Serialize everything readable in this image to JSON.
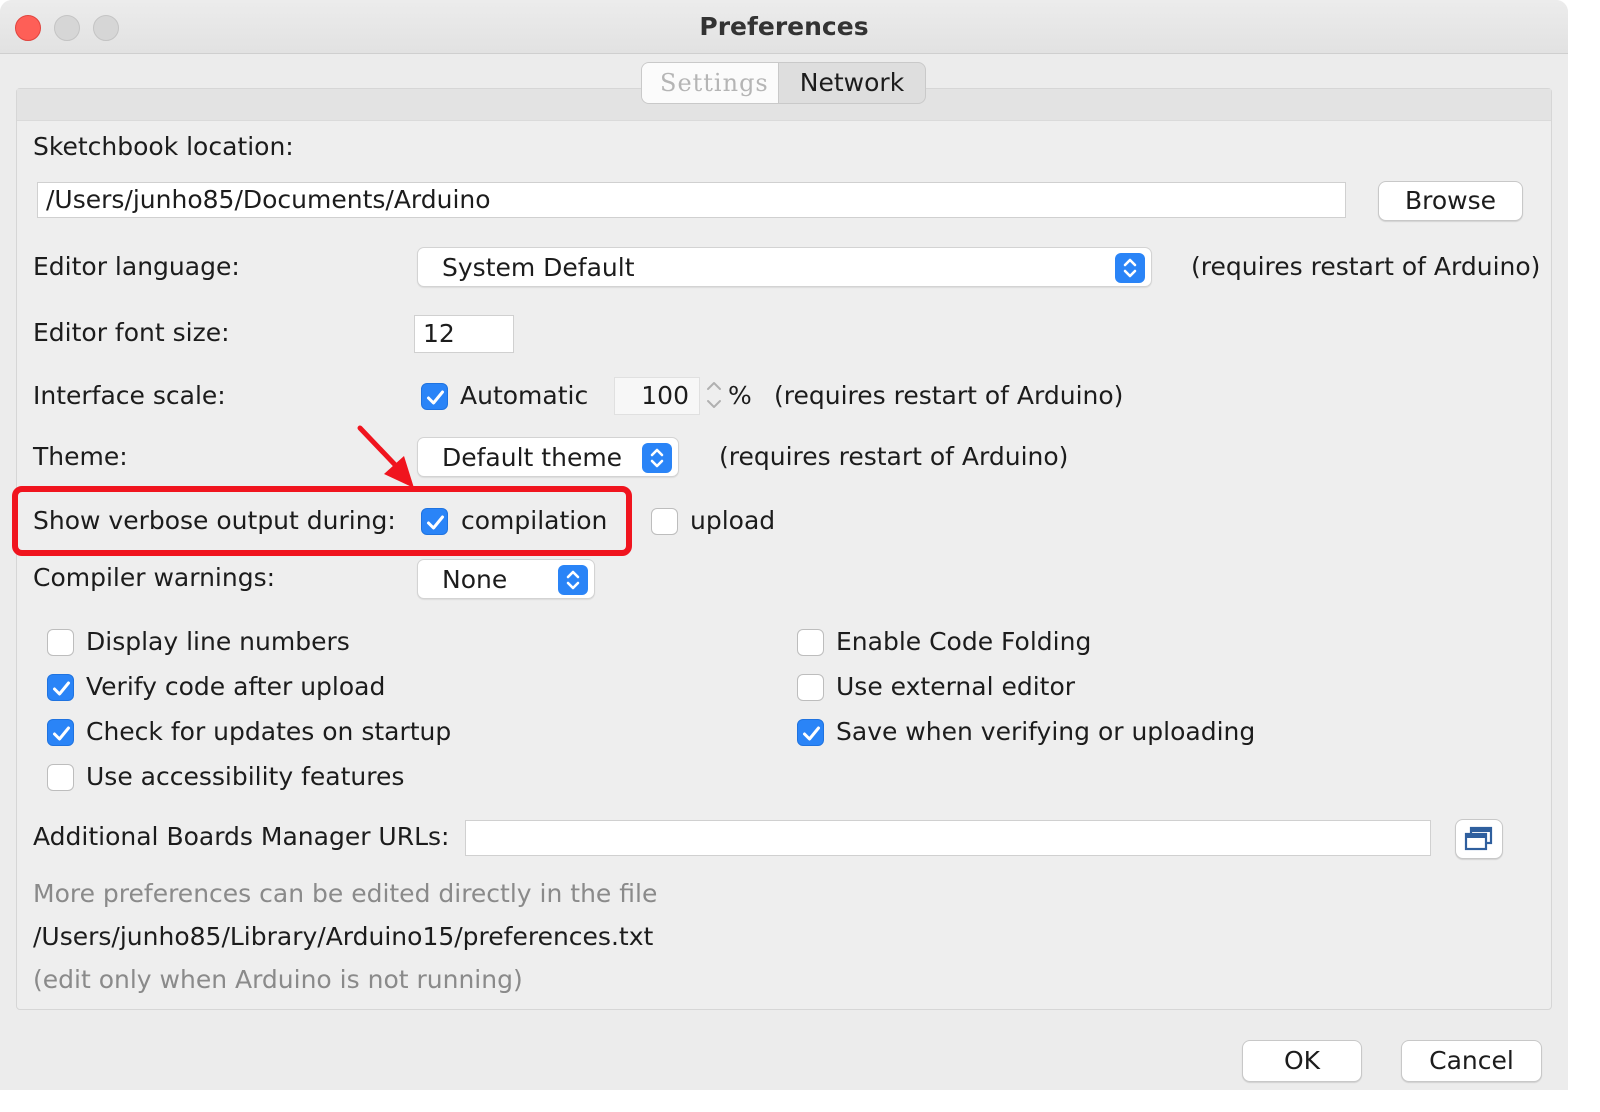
{
  "window": {
    "title": "Preferences"
  },
  "tabs": [
    {
      "label": "Settings",
      "active": true
    },
    {
      "label": "Network",
      "active": false
    }
  ],
  "sketchbook": {
    "label": "Sketchbook location:",
    "path": "/Users/junho85/Documents/Arduino",
    "browse_label": "Browse"
  },
  "editor_language": {
    "label": "Editor language:",
    "value": "System Default",
    "note": "(requires restart of Arduino)"
  },
  "editor_font_size": {
    "label": "Editor font size:",
    "value": "12"
  },
  "interface_scale": {
    "label": "Interface scale:",
    "automatic_label": "Automatic",
    "automatic_checked": true,
    "value": "100",
    "unit": "%",
    "note": "(requires restart of Arduino)"
  },
  "theme": {
    "label": "Theme:",
    "value": "Default theme",
    "note": "(requires restart of Arduino)"
  },
  "verbose": {
    "label": "Show verbose output during:",
    "compilation_label": "compilation",
    "compilation_checked": true,
    "upload_label": "upload",
    "upload_checked": false
  },
  "compiler_warnings": {
    "label": "Compiler warnings:",
    "value": "None"
  },
  "options_left": [
    {
      "label": "Display line numbers",
      "checked": false
    },
    {
      "label": "Verify code after upload",
      "checked": true
    },
    {
      "label": "Check for updates on startup",
      "checked": true
    },
    {
      "label": "Use accessibility features",
      "checked": false
    }
  ],
  "options_right": [
    {
      "label": "Enable Code Folding",
      "checked": false
    },
    {
      "label": "Use external editor",
      "checked": false
    },
    {
      "label": "Save when verifying or uploading",
      "checked": true
    }
  ],
  "boards_manager": {
    "label": "Additional Boards Manager URLs:",
    "value": ""
  },
  "footer": {
    "more_prefs": "More preferences can be edited directly in the file",
    "prefs_path": "/Users/junho85/Library/Arduino15/preferences.txt",
    "edit_note": "(edit only when Arduino is not running)"
  },
  "buttons": {
    "ok": "OK",
    "cancel": "Cancel"
  },
  "colors": {
    "accent": "#2a84f7",
    "highlight": "#f0141e",
    "close": "#fe5f57"
  },
  "icons": {
    "select": "updown-chevron-icon",
    "check": "checkmark-icon",
    "boards": "window-stack-icon",
    "annotation": "red-arrow-icon"
  }
}
